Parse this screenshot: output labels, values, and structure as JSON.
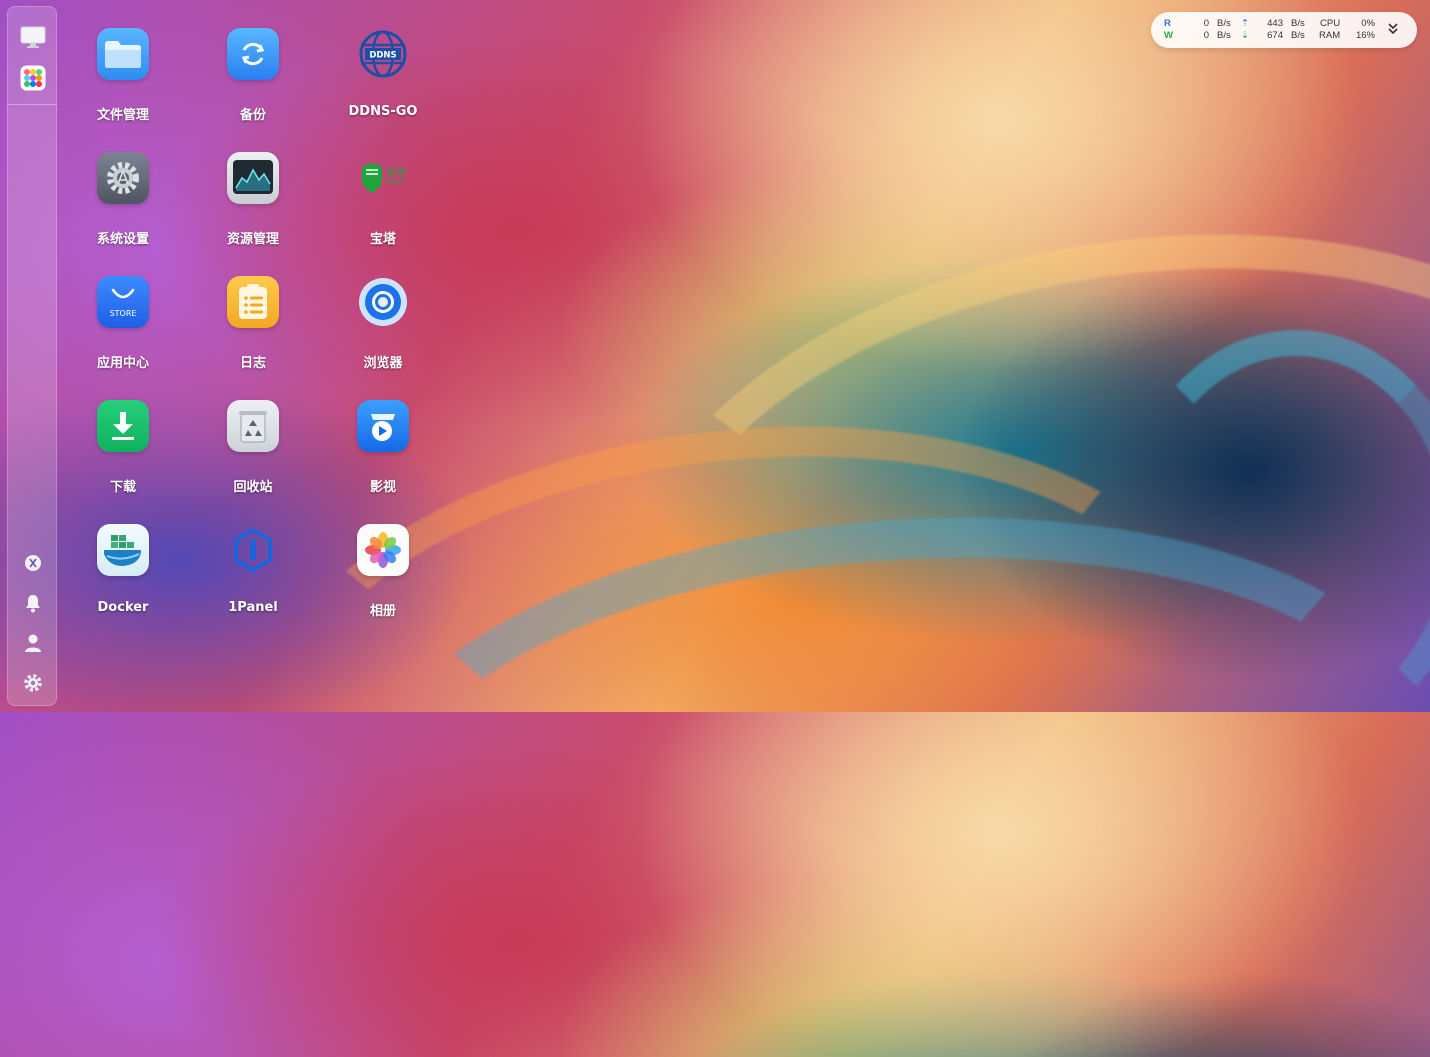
{
  "desktop_apps": [
    {
      "label": "文件管理",
      "icon": "folder-icon"
    },
    {
      "label": "备份",
      "icon": "backup-sync-icon"
    },
    {
      "label": "DDNS-GO",
      "icon": "ddns-globe-icon",
      "badge": "DDNS"
    },
    {
      "label": "系统设置",
      "icon": "gear-settings-icon"
    },
    {
      "label": "资源管理",
      "icon": "activity-monitor-icon"
    },
    {
      "label": "宝塔",
      "icon": "baota-shield-icon",
      "badge": "宝塔"
    },
    {
      "label": "应用中心",
      "icon": "store-bag-icon",
      "badge": "STORE"
    },
    {
      "label": "日志",
      "icon": "clipboard-log-icon"
    },
    {
      "label": "浏览器",
      "icon": "browser-icon"
    },
    {
      "label": "下载",
      "icon": "download-icon"
    },
    {
      "label": "回收站",
      "icon": "recycle-bin-icon"
    },
    {
      "label": "影视",
      "icon": "video-play-icon"
    },
    {
      "label": "Docker",
      "icon": "docker-whale-icon"
    },
    {
      "label": "1Panel",
      "icon": "1panel-hexagon-icon"
    },
    {
      "label": "相册",
      "icon": "photos-flower-icon"
    }
  ],
  "sidebar": {
    "top_items": [
      {
        "icon": "monitor-icon"
      },
      {
        "icon": "app-grid-icon"
      }
    ],
    "bottom_items": [
      {
        "icon": "power-recycle-icon"
      },
      {
        "icon": "bell-icon"
      },
      {
        "icon": "user-icon"
      },
      {
        "icon": "settings-cog-icon"
      }
    ]
  },
  "system_monitor": {
    "read_label": "R",
    "write_label": "W",
    "read_rate": "0",
    "write_rate": "0",
    "upload_rate": "443",
    "download_rate": "674",
    "unit": "B/s",
    "cpu_label": "CPU",
    "cpu_value": "0%",
    "ram_label": "RAM",
    "ram_value": "16%"
  },
  "colors": {
    "read": "#2f6fd6",
    "write": "#2aa84a",
    "upload": "#2f6fd6",
    "download": "#2aa84a"
  }
}
